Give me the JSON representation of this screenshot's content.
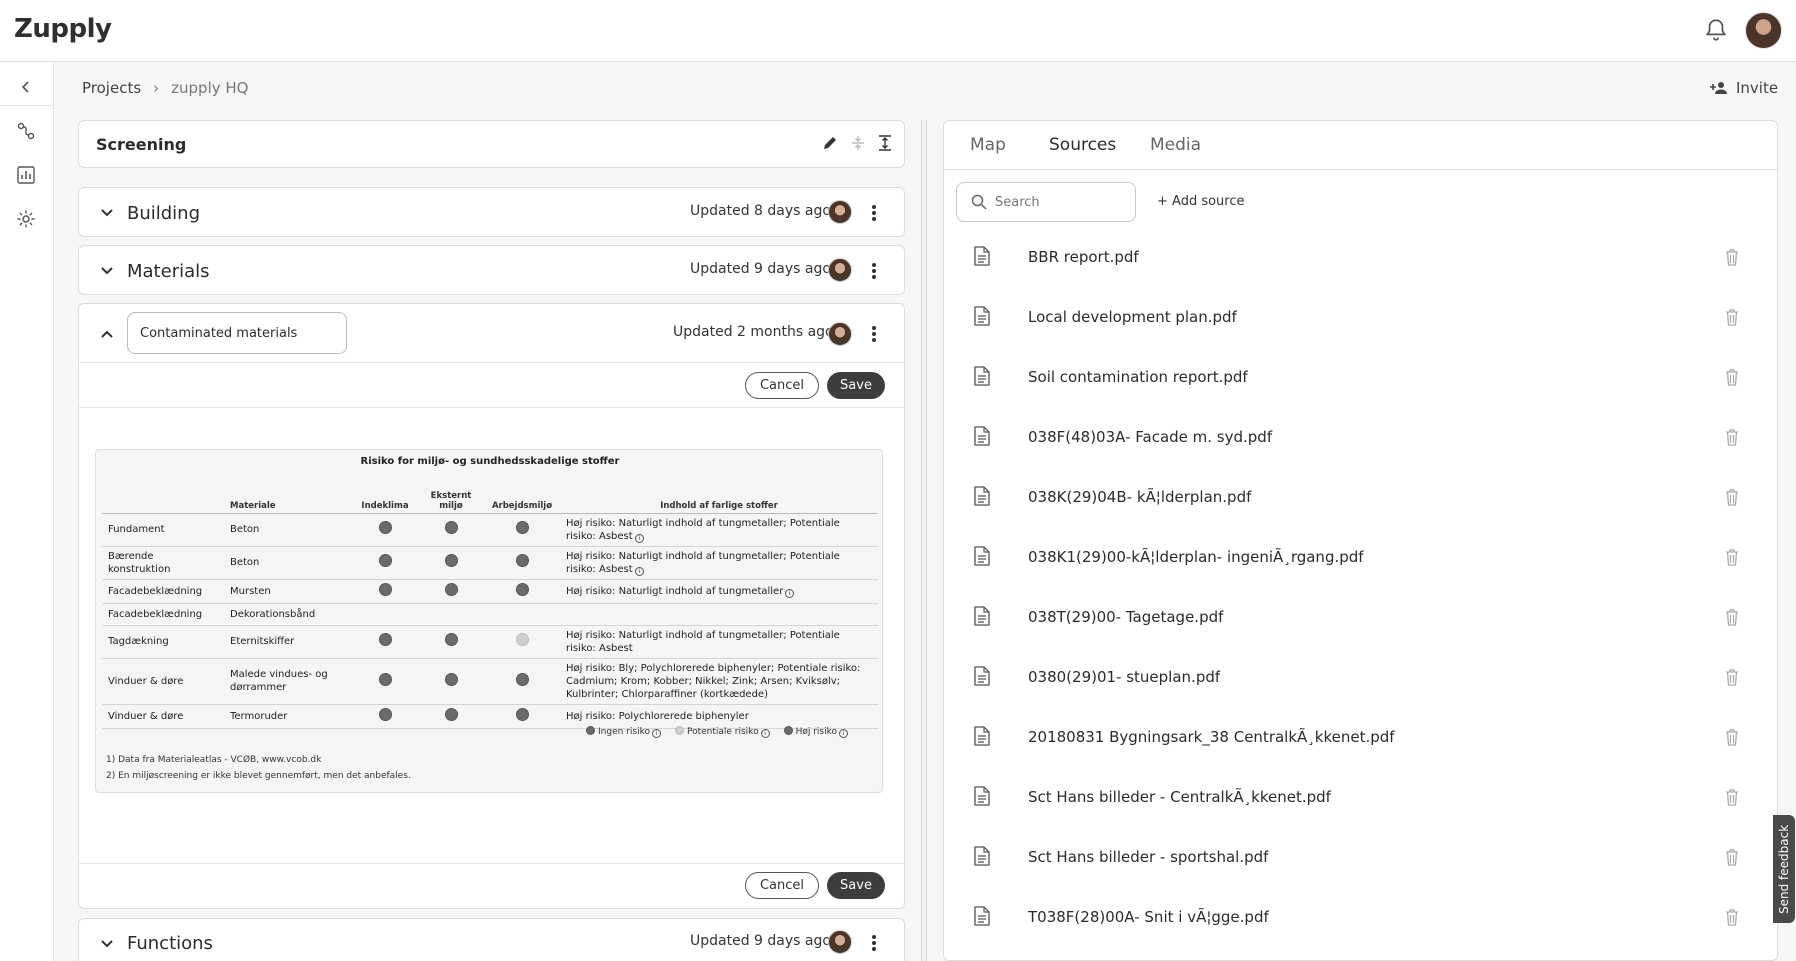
{
  "app": {
    "logo": "Zupply"
  },
  "breadcrumb": {
    "root": "Projects",
    "current": "zupply HQ",
    "separator": "›"
  },
  "header": {
    "invite_label": "Invite"
  },
  "screening": {
    "title": "Screening"
  },
  "sections": {
    "building": {
      "title": "Building",
      "updated": "Updated 8 days ago"
    },
    "materials": {
      "title": "Materials",
      "updated": "Updated 9 days ago"
    },
    "contaminated": {
      "title_value": "Contaminated materials",
      "updated": "Updated 2 months ago",
      "cancel_label": "Cancel",
      "save_label": "Save"
    },
    "functions": {
      "title": "Functions",
      "updated": "Updated 9 days ago"
    }
  },
  "risk_table": {
    "title": "Risiko for miljø- og sundhedsskadelige stoffer",
    "headers": {
      "material": "Materiale",
      "indoor": "Indeklima",
      "external": "Eksternt miljø",
      "work": "Arbejdsmiljø",
      "content": "Indhold af farlige stoffer"
    },
    "rows": [
      {
        "part": "Fundament",
        "material": "Beton",
        "content": "Høj risiko: Naturligt indhold af tungmetaller; Potentiale risiko: Asbest"
      },
      {
        "part": "Bærende konstruktion",
        "material": "Beton",
        "content": "Høj risiko: Naturligt indhold af tungmetaller; Potentiale risiko: Asbest"
      },
      {
        "part": "Facadebeklædning",
        "material": "Mursten",
        "content": "Høj risiko: Naturligt indhold af tungmetaller"
      },
      {
        "part": "Facadebeklædning",
        "material": "Dekorationsbånd",
        "content": ""
      },
      {
        "part": "Tagdækning",
        "material": "Eternitskiffer",
        "content": "Høj risiko: Naturligt indhold af tungmetaller; Potentiale risiko: Asbest"
      },
      {
        "part": "Vinduer & døre",
        "material": "Malede vindues- og dørrammer",
        "content": "Høj risiko: Bly; Polychlorerede biphenyler; Potentiale risiko: Cadmium; Krom; Kobber; Nikkel; Zink; Arsen; Kviksølv; Kulbrinter; Chlorparaffiner (kortkædede)"
      },
      {
        "part": "Vinduer & døre",
        "material": "Termoruder",
        "content": "Høj risiko: Polychlorerede biphenyler"
      }
    ],
    "legend": {
      "none": "Ingen risiko",
      "potential": "Potentiale risiko",
      "high": "Høj risiko"
    },
    "footnote_1": "1) Data fra Materialeatlas - VCØB, www.vcob.dk",
    "footnote_2": "2) En miljøscreening er ikke blevet gennemført, men det anbefales."
  },
  "right_panel": {
    "tabs": [
      "Map",
      "Sources",
      "Media"
    ],
    "active_tab": "Sources",
    "search_placeholder": "Search",
    "add_source_label": "+ Add source",
    "sources": [
      "BBR report.pdf",
      "Local development plan.pdf",
      "Soil contamination report.pdf",
      "038F(48)03A- Facade m. syd.pdf",
      "038K(29)04B- kÃ¦lderplan.pdf",
      "038K1(29)00-kÃ¦lderplan- ingeniÃ¸rgang.pdf",
      "038T(29)00- Tagetage.pdf",
      "0380(29)01- stueplan.pdf",
      "20180831 Bygningsark_38 CentralkÃ¸kkenet.pdf",
      "Sct Hans billeder - CentralkÃ¸kkenet.pdf",
      "Sct Hans billeder - sportshal.pdf",
      "T038F(28)00A- Snit i vÃ¦gge.pdf"
    ]
  },
  "feedback_label": "Send feedback"
}
